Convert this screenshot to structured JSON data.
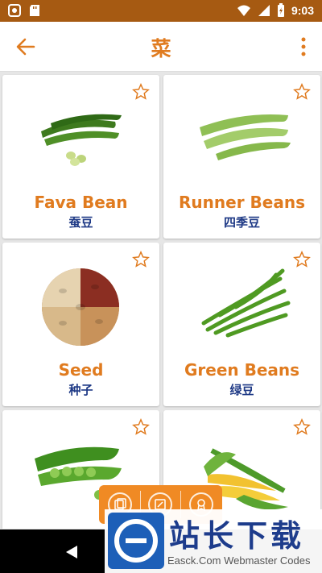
{
  "status_bar": {
    "time": "9:03"
  },
  "app_bar": {
    "title": "菜"
  },
  "cards": [
    {
      "en": "Fava Bean",
      "zh": "蚕豆",
      "image": "fava-bean-image"
    },
    {
      "en": "Runner Beans",
      "zh": "四季豆",
      "image": "runner-beans-image"
    },
    {
      "en": "Seed",
      "zh": "种子",
      "image": "seed-image"
    },
    {
      "en": "Green Beans",
      "zh": "绿豆",
      "image": "green-beans-image"
    },
    {
      "en": "",
      "zh": "",
      "image": "peas-image"
    },
    {
      "en": "",
      "zh": "",
      "image": "corn-image"
    }
  ],
  "watermark": {
    "title": "站长下载",
    "subtitle": "Easck.Com Webmaster Codes"
  },
  "colors": {
    "accent": "#e07b1f",
    "status_bar": "#a65a12",
    "label_zh": "#1f3a86"
  }
}
